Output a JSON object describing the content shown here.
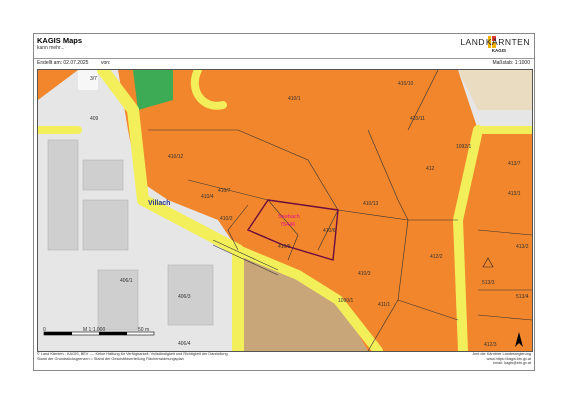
{
  "header": {
    "title": "KAGIS Maps",
    "subtitle": "kann mehr...",
    "logo_left": "LAND",
    "logo_right": "KÄRNTEN",
    "logo_sub": "KAGIS",
    "created_label": "Erstellt am: 02.07.2025",
    "by_label": "von:",
    "scale_label": "Maßstab: 1:1000"
  },
  "map": {
    "place_name": "Villach",
    "highlight_parcel": {
      "line1": "Seebach",
      "line2": "75446"
    },
    "parcels": [
      "3/7",
      "409",
      "410/1",
      "410/10",
      "410/11",
      "410/12",
      "410/7",
      "410/4",
      "410/2",
      "410/5",
      "410/6",
      "410/13",
      "410/3",
      "411/1",
      "412",
      "412/2",
      "413/7",
      "413/1",
      "1092/1",
      "406/1",
      "406/3",
      "406/4",
      "1090/1",
      "513/3",
      "513/4",
      "412/3",
      "413/2"
    ],
    "scalebar": {
      "left": "0",
      "middle": "M 1:1.000",
      "right": "50 m"
    },
    "north_arrow": "north-arrow"
  },
  "colors": {
    "orange": "#f2862c",
    "yellow": "#f3ef5a",
    "buildings": "#d0d0d0",
    "brown": "#c9a57a",
    "green": "#3daa55",
    "highlight": "#e0118a"
  },
  "footer": {
    "left_line1": "© Land Kärnten - KAGIS, BEV ---- Keine Haftung für Verfügbarkeit, Vollständigkeit und Richtigkeit der Darstellung",
    "left_line2": "Stand der Grundstücksgrenzen = Stand der Geschäftsverteilung Flächenwidmungsplan",
    "right_line1": "Amt der Kärntner Landesregierung",
    "right_line2": "www.https://kagis.ktn.gv.at",
    "right_line3": "email: kagis@ktn.gv.at"
  }
}
